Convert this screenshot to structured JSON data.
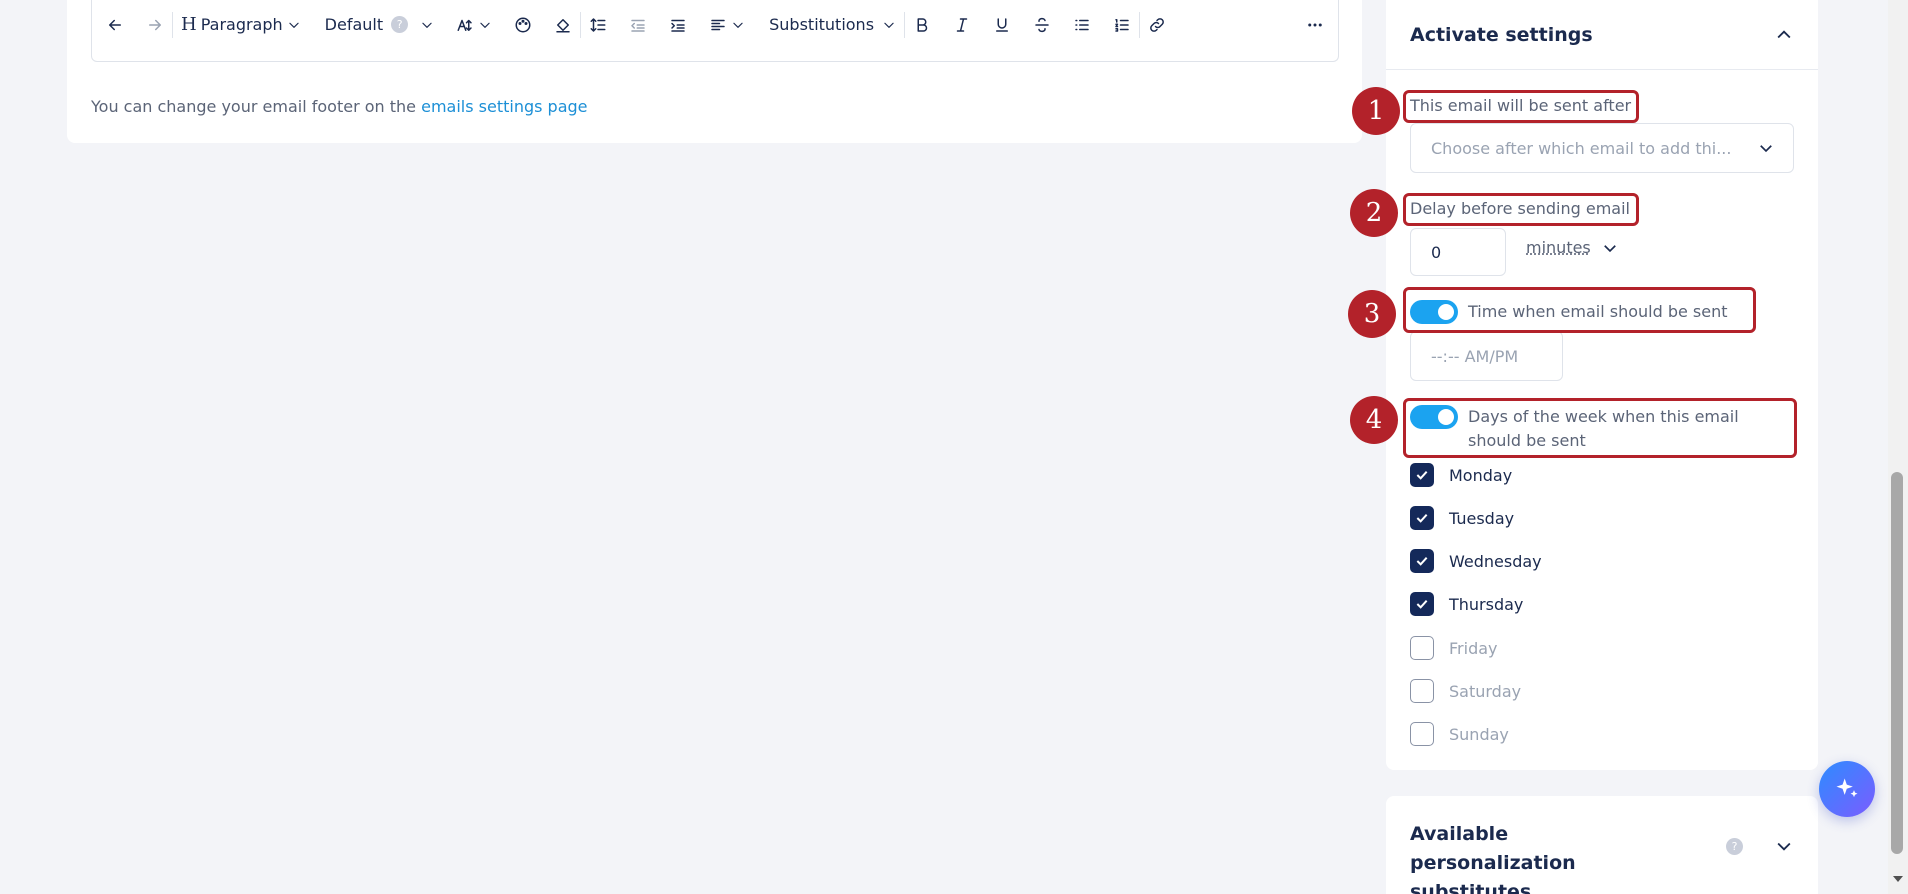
{
  "toolbar": {
    "undo_icon": "arrow-left-icon",
    "redo_icon": "arrow-right-icon",
    "heading_label": "Paragraph",
    "font_label": "Default",
    "help_glyph": "?",
    "substitutions_label": "Substitutions",
    "more_icon": "ellipsis-icon"
  },
  "footer_note": {
    "text": "You can change your email footer on the ",
    "link": "emails settings page"
  },
  "activate": {
    "title": "Activate settings",
    "sent_after_label": "This email will be sent after",
    "sent_after_placeholder": "Choose after which email to add thi...",
    "delay_label": "Delay before sending email",
    "delay_value": "0",
    "delay_unit": "minutes",
    "time_toggle_label": "Time when email should be sent",
    "time_placeholder": "--:-- AM/PM",
    "days_toggle_label": "Days of the week when this email should be sent",
    "days": [
      {
        "label": "Monday",
        "checked": true
      },
      {
        "label": "Tuesday",
        "checked": true
      },
      {
        "label": "Wednesday",
        "checked": true
      },
      {
        "label": "Thursday",
        "checked": true
      },
      {
        "label": "Friday",
        "checked": false
      },
      {
        "label": "Saturday",
        "checked": false
      },
      {
        "label": "Sunday",
        "checked": false
      }
    ]
  },
  "markers": [
    "1",
    "2",
    "3",
    "4"
  ],
  "personalization": {
    "title": "Available personalization substitutes",
    "help_glyph": "?"
  },
  "colors": {
    "accent": "#1ba3f0",
    "marker": "#b3222a",
    "checkbox": "#14295a",
    "link": "#1c8fd6"
  }
}
